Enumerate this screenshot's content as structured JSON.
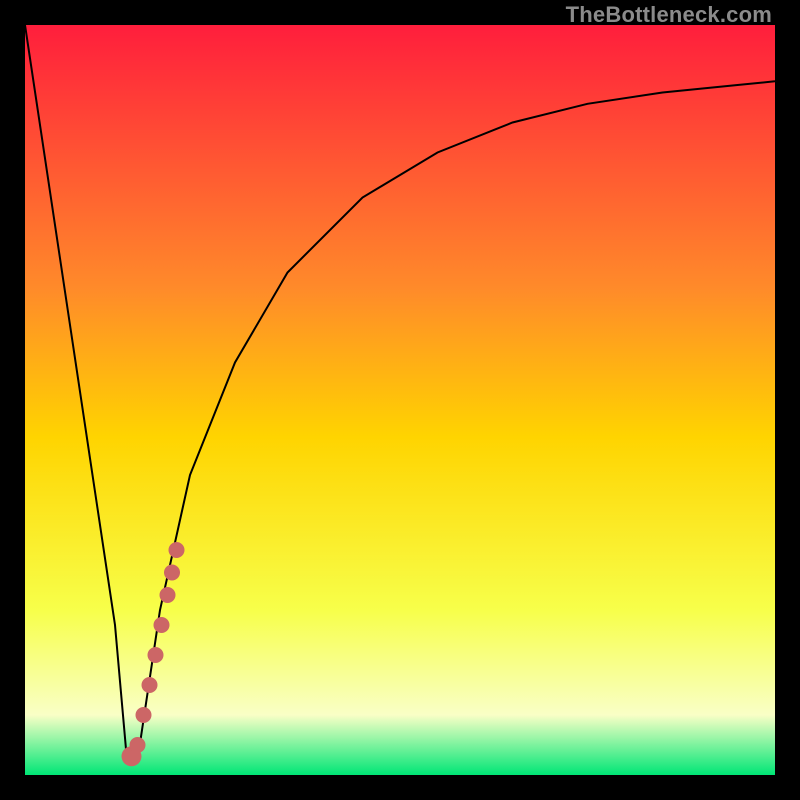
{
  "watermark": "TheBottleneck.com",
  "colors": {
    "gradient_top": "#ff1e3c",
    "gradient_mid_upper": "#ff8a2a",
    "gradient_mid": "#ffd400",
    "gradient_mid_lower": "#f7ff4a",
    "gradient_pale": "#f9ffc6",
    "gradient_bottom": "#00e676",
    "frame": "#000000",
    "curve": "#000000",
    "marker": "#cc6666"
  },
  "chart_data": {
    "type": "line",
    "title": "",
    "xlabel": "",
    "ylabel": "",
    "xlim": [
      0,
      100
    ],
    "ylim": [
      0,
      100
    ],
    "series": [
      {
        "name": "bottleneck-curve",
        "x": [
          0,
          3,
          6,
          9,
          12,
          13.5,
          15,
          18,
          22,
          28,
          35,
          45,
          55,
          65,
          75,
          85,
          95,
          100
        ],
        "y": [
          100,
          80,
          60,
          40,
          20,
          3,
          2,
          22,
          40,
          55,
          67,
          77,
          83,
          87,
          89.5,
          91,
          92,
          92.5
        ]
      }
    ],
    "markers": {
      "name": "highlight",
      "x": [
        14.2,
        15.0,
        15.8,
        16.6,
        17.4,
        18.2,
        19.0,
        19.6,
        20.2
      ],
      "y": [
        2.5,
        4.0,
        8.0,
        12.0,
        16.0,
        20.0,
        24.0,
        27.0,
        30.0
      ]
    }
  }
}
